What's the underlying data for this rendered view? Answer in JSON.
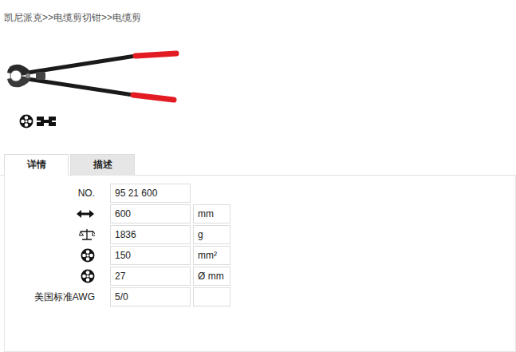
{
  "breadcrumb": "凯尼派克>>电缆剪切钳>>电缆剪",
  "tabs": [
    {
      "label": "详情",
      "selected": true
    },
    {
      "label": "描述",
      "selected": false
    }
  ],
  "specs": [
    {
      "kind": "text",
      "label": "NO.",
      "value": "95 21 600"
    },
    {
      "kind": "length",
      "value": "600",
      "unit": "mm"
    },
    {
      "kind": "weight",
      "value": "1836",
      "unit": "g"
    },
    {
      "kind": "cross-section",
      "value": "150",
      "unit": "mm²"
    },
    {
      "kind": "diameter",
      "value": "27",
      "unit": "Ø mm"
    },
    {
      "kind": "text",
      "label": "美国标准AWG",
      "value": "5/0",
      "unit": ""
    }
  ]
}
